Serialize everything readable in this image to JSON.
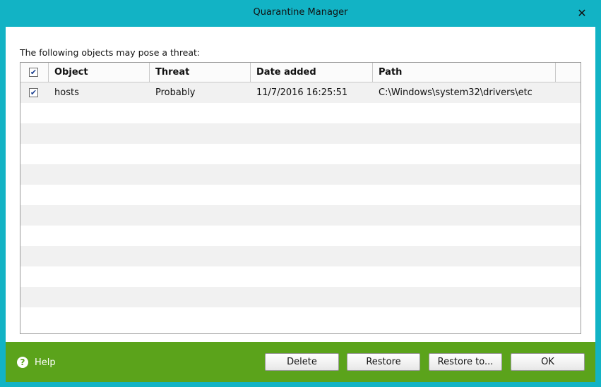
{
  "window": {
    "title": "Quarantine Manager",
    "close_glyph": "✕"
  },
  "caption": "The following objects may pose a threat:",
  "table": {
    "columns": [
      "Object",
      "Threat",
      "Date added",
      "Path"
    ],
    "rows": [
      {
        "checked": true,
        "object": "hosts",
        "threat": "Probably",
        "date_added": "11/7/2016 16:25:51",
        "path": "C:\\Windows\\system32\\drivers\\etc"
      }
    ]
  },
  "footer": {
    "help_label": "Help",
    "help_icon": "?",
    "buttons": {
      "delete": "Delete",
      "restore": "Restore",
      "restore_to": "Restore to...",
      "ok": "OK"
    }
  },
  "check_glyph": "✔",
  "colors": {
    "title_bg": "#12b3c5",
    "footer_bg": "#5ba31b"
  }
}
